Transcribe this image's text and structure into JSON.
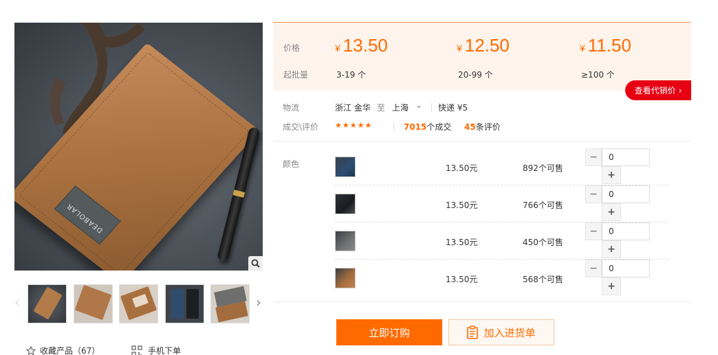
{
  "gallery": {
    "main_image_alt": "DEABOLAR",
    "thumbnails": [
      {
        "name": "thumb-brown-front"
      },
      {
        "name": "thumb-brown-open"
      },
      {
        "name": "thumb-brown-inside"
      },
      {
        "name": "thumb-blue-black"
      },
      {
        "name": "thumb-grey-brown"
      }
    ]
  },
  "actions_bottom": {
    "favorite_label": "收藏产品",
    "favorite_count": "（67）",
    "mobile_order_label": "手机下单"
  },
  "price_box": {
    "price_label": "价格",
    "moq_label": "起批量",
    "currency": "¥",
    "tiers": [
      {
        "price": "13.50",
        "range": "3-19 个"
      },
      {
        "price": "12.50",
        "range": "20-99 个"
      },
      {
        "price": "11.50",
        "range": "≥100 个"
      }
    ],
    "agent_button": "查看代销价"
  },
  "logistics": {
    "label": "物流",
    "from": "浙江 金华",
    "to_word": "至",
    "to": "上海",
    "express": "快递 ¥5"
  },
  "trade": {
    "label": "成交\\评价",
    "stars": "★★★★★",
    "deals_count": "7015",
    "deals_suffix": "个成交",
    "reviews_count": "45",
    "reviews_suffix": "条评价"
  },
  "sku": {
    "color_label": "颜色",
    "rows": [
      {
        "price": "13.50元",
        "stock": "892个可售",
        "qty": "0"
      },
      {
        "price": "13.50元",
        "stock": "766个可售",
        "qty": "0"
      },
      {
        "price": "13.50元",
        "stock": "450个可售",
        "qty": "0"
      },
      {
        "price": "13.50元",
        "stock": "568个可售",
        "qty": "0"
      }
    ],
    "minus": "−",
    "plus": "+"
  },
  "buttons": {
    "buy_now": "立即订购",
    "add_to_list": "加入进货单"
  },
  "colors": {
    "accent": "#ff6a00",
    "agent_red": "#e60012",
    "price_bg": "#fff4ec"
  }
}
